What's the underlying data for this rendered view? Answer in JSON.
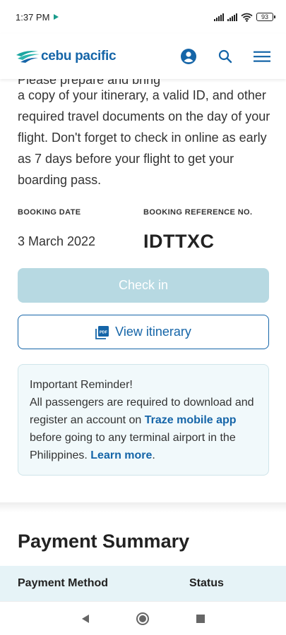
{
  "status_bar": {
    "time": "1:37 PM",
    "battery": "93",
    "icons": [
      "play-icon",
      "signal-icon",
      "wifi-icon",
      "battery-icon"
    ]
  },
  "header": {
    "logo_text": "cebu pacific",
    "icons": [
      "account-icon",
      "search-icon",
      "menu-icon"
    ],
    "brand_color": "#1565a8"
  },
  "intro": {
    "cut_text": "Please prepare and bring",
    "text": "a copy of your itinerary, a valid ID, and other required travel documents on the day of your flight. Don't forget to check in online as early as 7 days before your flight to get your boarding pass."
  },
  "booking": {
    "date_label": "BOOKING DATE",
    "ref_label": "BOOKING REFERENCE NO.",
    "date_value": "3 March 2022",
    "ref_value": "IDTTXC"
  },
  "actions": {
    "checkin_label": "Check in",
    "view_label": "View itinerary",
    "pdf_icon_text": "PDF"
  },
  "reminder": {
    "title": "Important Reminder!",
    "text_before": "All passengers are required to download and register an account on ",
    "app_link": "Traze mobile app",
    "text_after": " before going to any terminal airport in the Philippines. ",
    "learn_more": "Learn more",
    "period": "."
  },
  "payment": {
    "title": "Payment Summary",
    "columns": [
      "Payment Method",
      "Status"
    ]
  },
  "nav": {
    "icons": [
      "back-icon",
      "home-icon",
      "recents-icon"
    ]
  }
}
